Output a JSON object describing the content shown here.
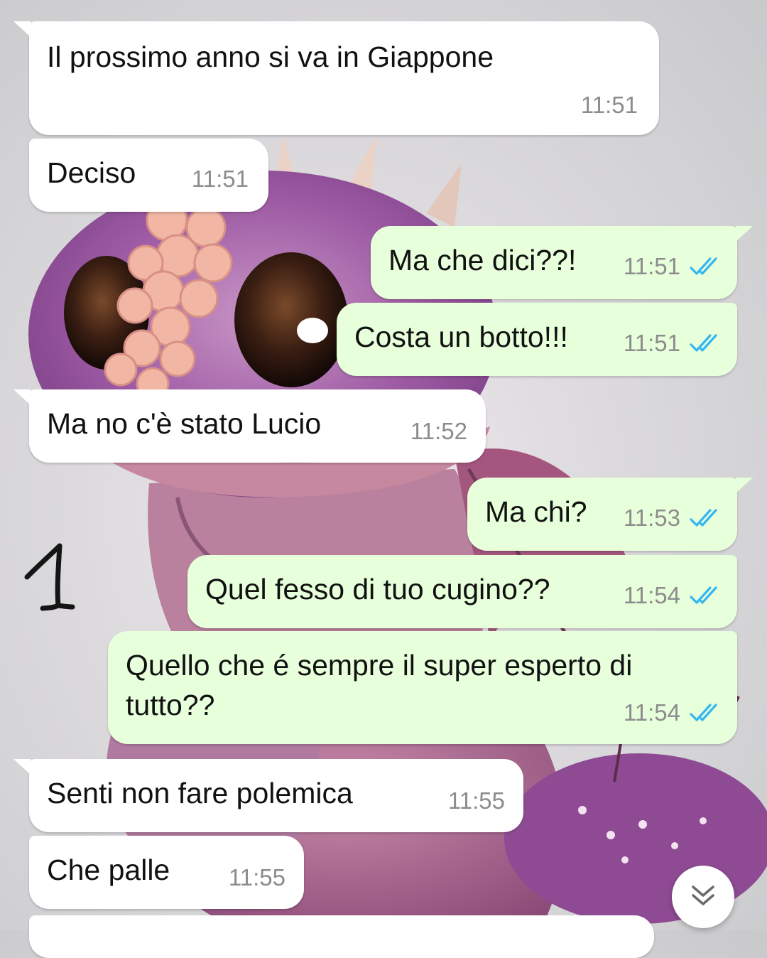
{
  "chat": {
    "messages": [
      {
        "direction": "in",
        "text": "Il prossimo anno si va in Giappone",
        "time": "11:51"
      },
      {
        "direction": "in",
        "text": "Deciso",
        "time": "11:51"
      },
      {
        "direction": "out",
        "text": "Ma che dici??!",
        "time": "11:51",
        "status": "read"
      },
      {
        "direction": "out",
        "text": "Costa un botto!!!",
        "time": "11:51",
        "status": "read"
      },
      {
        "direction": "in",
        "text": "Ma no c'è stato Lucio",
        "time": "11:52"
      },
      {
        "direction": "out",
        "text": "Ma chi?",
        "time": "11:53",
        "status": "read"
      },
      {
        "direction": "out",
        "text": "Quel fesso di tuo cugino??",
        "time": "11:54",
        "status": "read"
      },
      {
        "direction": "out",
        "text": "Quello che é sempre il super esperto di tutto??",
        "time": "11:54",
        "status": "read"
      },
      {
        "direction": "in",
        "text": "Senti non fare polemica",
        "time": "11:55"
      },
      {
        "direction": "in",
        "text": "Che palle",
        "time": "11:55"
      }
    ]
  },
  "annotation": {
    "text": "1"
  },
  "colors": {
    "incoming_bubble": "#ffffff",
    "outgoing_bubble": "#e7ffdb",
    "read_ticks": "#34b7f1",
    "timestamp": "#8c8c8c"
  },
  "icons": {
    "read_receipt": "double-check-icon",
    "scroll_down": "double-chevron-down-icon",
    "wallpaper": "baby-dragon-wallpaper"
  }
}
